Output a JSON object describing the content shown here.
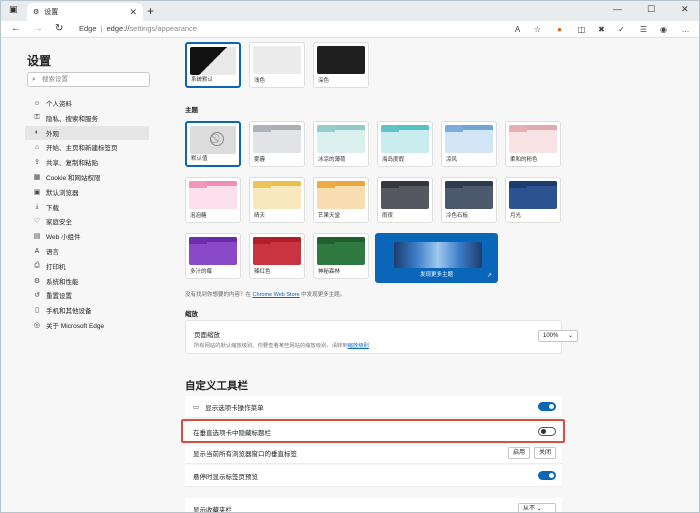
{
  "browser": {
    "tab_title": "设置",
    "address_prefix": "Edge",
    "address_host": "edge://",
    "address_path": "settings/appearance",
    "accent": "#0a66b8"
  },
  "sidebar": {
    "title": "设置",
    "search_placeholder": "搜索设置",
    "items": [
      {
        "icon": "user-icon",
        "label": "个人资料"
      },
      {
        "icon": "lock-icon",
        "label": "隐私、搜索和服务"
      },
      {
        "icon": "palette-icon",
        "label": "外观"
      },
      {
        "icon": "start-icon",
        "label": "开始、主页和新建标签页"
      },
      {
        "icon": "share-icon",
        "label": "共享、复制和粘贴"
      },
      {
        "icon": "cookie-icon",
        "label": "Cookie 和网站权限"
      },
      {
        "icon": "browser-icon",
        "label": "默认浏览器"
      },
      {
        "icon": "download-icon",
        "label": "下载"
      },
      {
        "icon": "family-icon",
        "label": "家庭安全"
      },
      {
        "icon": "widget-icon",
        "label": "Web 小组件"
      },
      {
        "icon": "language-icon",
        "label": "语言"
      },
      {
        "icon": "printer-icon",
        "label": "打印机"
      },
      {
        "icon": "system-icon",
        "label": "系统和性能"
      },
      {
        "icon": "reset-icon",
        "label": "重置设置"
      },
      {
        "icon": "phone-icon",
        "label": "手机和其他设备"
      },
      {
        "icon": "edge-icon",
        "label": "关于 Microsoft Edge"
      }
    ]
  },
  "appearance": {
    "modes": [
      "系统默认",
      "浅色",
      "深色"
    ],
    "theme_header": "主题",
    "themes": [
      {
        "label": "默认值"
      },
      {
        "label": "雾霾"
      },
      {
        "label": "冰凉的薄荷"
      },
      {
        "label": "海岛度假"
      },
      {
        "label": "凉风"
      },
      {
        "label": "柔和的粉色"
      },
      {
        "label": "泡泡糖"
      },
      {
        "label": "晴天"
      },
      {
        "label": "芒果天堂"
      },
      {
        "label": "雨夜"
      },
      {
        "label": "冷色石板"
      },
      {
        "label": "月光"
      },
      {
        "label": "多汁的莓"
      },
      {
        "label": "辣红色"
      },
      {
        "label": "神秘森林"
      }
    ],
    "discover_label": "发现更多主题",
    "store_text_pre": "没有找到你想要的内容？在",
    "store_link": "Chrome Web Store",
    "store_text_post": "中发现更多主题。",
    "zoom_header": "缩放",
    "zoom_title": "页面缩放",
    "zoom_desc": "所有网站的默认缩放级别。你要查看某些网站的缩放级别，请转到",
    "zoom_link": "缩放级别",
    "zoom_value": "100%"
  },
  "toolbar": {
    "title": "自定义工具栏",
    "rows": [
      {
        "label": "显示选项卡操作菜单"
      },
      {
        "label": "在垂直选项卡中隐藏标题栏"
      },
      {
        "label": "显示当前所有浏览器窗口的垂直标签"
      },
      {
        "label": "悬停时显示标签页预览"
      },
      {
        "label": "显示收藏夹栏"
      }
    ],
    "vertical_on": "启用",
    "vertical_off": "关闭",
    "favorites_value": "从不"
  }
}
